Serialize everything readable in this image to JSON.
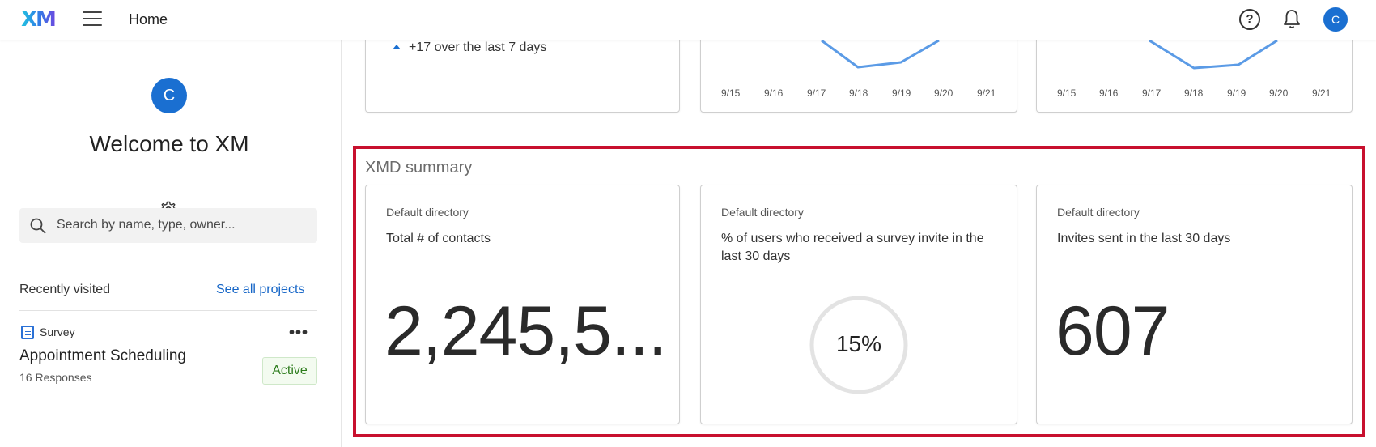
{
  "topbar": {
    "logo": "XM",
    "title": "Home",
    "avatar_initial": "C"
  },
  "sidebar": {
    "avatar_initial": "C",
    "welcome": "Welcome to XM",
    "search_placeholder": "Search by name, type, owner...",
    "recently_visited": "Recently visited",
    "see_all": "See all projects",
    "project": {
      "type": "Survey",
      "name": "Appointment Scheduling",
      "responses": "16 Responses",
      "status": "Active"
    }
  },
  "top_cards": {
    "trend_text": "+17 over the last 7 days",
    "chart_ticks": [
      "9/15",
      "9/16",
      "9/17",
      "9/18",
      "9/19",
      "9/20",
      "9/21"
    ],
    "line_color": "#5b9be6"
  },
  "xmd": {
    "title": "XMD summary",
    "cards": [
      {
        "subtitle": "Default directory",
        "title": "Total # of contacts",
        "value": "2,245,5..."
      },
      {
        "subtitle": "Default directory",
        "title": "% of users who received a survey invite in the last 30 days",
        "value": "15%"
      },
      {
        "subtitle": "Default directory",
        "title": "Invites sent in the last 30 days",
        "value": "607"
      }
    ],
    "donut_percent": 15,
    "highlight_color": "#c8102e"
  }
}
